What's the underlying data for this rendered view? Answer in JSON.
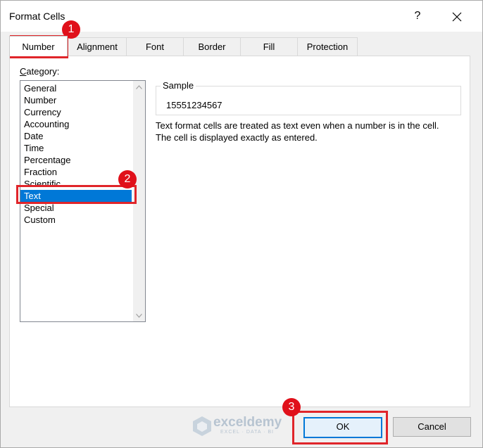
{
  "window": {
    "title": "Format Cells",
    "help_label": "?"
  },
  "tabs": [
    {
      "label": "Number"
    },
    {
      "label": "Alignment"
    },
    {
      "label": "Font"
    },
    {
      "label": "Border"
    },
    {
      "label": "Fill"
    },
    {
      "label": "Protection"
    }
  ],
  "category": {
    "label_prefix": "C",
    "label_rest": "ategory:",
    "items": [
      "General",
      "Number",
      "Currency",
      "Accounting",
      "Date",
      "Time",
      "Percentage",
      "Fraction",
      "Scientific",
      "Text",
      "Special",
      "Custom"
    ],
    "selected": "Text"
  },
  "sample": {
    "legend": "Sample",
    "value": "15551234567"
  },
  "description": {
    "line1": "Text format cells are treated as text even when a number is in the cell.",
    "line2": "The cell is displayed exactly as entered."
  },
  "buttons": {
    "ok": "OK",
    "cancel": "Cancel"
  },
  "annotations": {
    "step1": "1",
    "step2": "2",
    "step3": "3",
    "color": "#e0252a"
  },
  "watermark": {
    "brand": "exceldemy",
    "tagline": "EXCEL · DATA · BI"
  },
  "colors": {
    "selection": "#0078d7",
    "ok_border": "#0078d7"
  }
}
